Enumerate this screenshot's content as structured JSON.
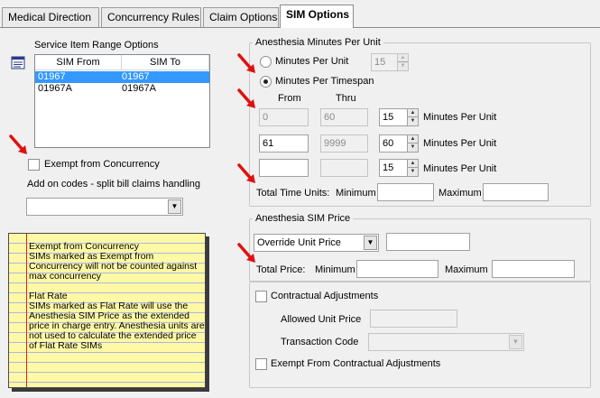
{
  "tabs": [
    {
      "label": "Medical Direction"
    },
    {
      "label": "Concurrency Rules"
    },
    {
      "label": "Claim Options"
    },
    {
      "label": "SIM Options"
    }
  ],
  "service_item": {
    "title": "Service Item Range Options",
    "columns": [
      "SIM From",
      "SIM To"
    ],
    "rows": [
      {
        "from": "01967",
        "to": "01967"
      },
      {
        "from": "01967A",
        "to": "01967A"
      }
    ],
    "exempt_label": "Exempt from Concurrency",
    "addon_label": "Add on codes - split bill claims handling",
    "addon_value": ""
  },
  "help_note": {
    "text": "Exempt from Concurrency\nSIMs marked as Exempt from Concurrency will not be counted against max concurrency\n\nFlat Rate\nSIMs marked as Flat Rate will use the Anesthesia SIM Price as the extended price in charge entry. Anesthesia units are not used to calculate the extended price of Flat Rate SIMs"
  },
  "anes_minutes": {
    "title": "Anesthesia Minutes Per Unit",
    "radio_minutes": "Minutes Per Unit",
    "radio_minutes_value": "15",
    "radio_timespan": "Minutes Per Timespan",
    "from_label": "From",
    "thru_label": "Thru",
    "mpu_label": "Minutes Per Unit",
    "rows": [
      {
        "from": "0",
        "thru": "60",
        "mpu": "15"
      },
      {
        "from": "61",
        "thru": "9999",
        "mpu": "60"
      },
      {
        "from": "",
        "thru": "",
        "mpu": "15"
      }
    ],
    "total_label": "Total Time Units:",
    "minimum_label": "Minimum",
    "maximum_label": "Maximum",
    "minimum_value": "",
    "maximum_value": ""
  },
  "sim_price": {
    "title": "Anesthesia SIM Price",
    "price_type": "Override Unit Price",
    "price_value": "",
    "total_label": "Total Price:",
    "minimum_label": "Minimum",
    "maximum_label": "Maximum",
    "minimum_value": "",
    "maximum_value": ""
  },
  "contractual": {
    "checkbox_label": "Contractual Adjustments",
    "allowed_label": "Allowed Unit Price",
    "allowed_value": "",
    "transaction_label": "Transaction Code",
    "transaction_value": "",
    "exempt_label": "Exempt From Contractual Adjustments"
  },
  "colors": {
    "selection": "#3399ff",
    "arrow": "#e01010",
    "note_background": "#fff9a5"
  }
}
